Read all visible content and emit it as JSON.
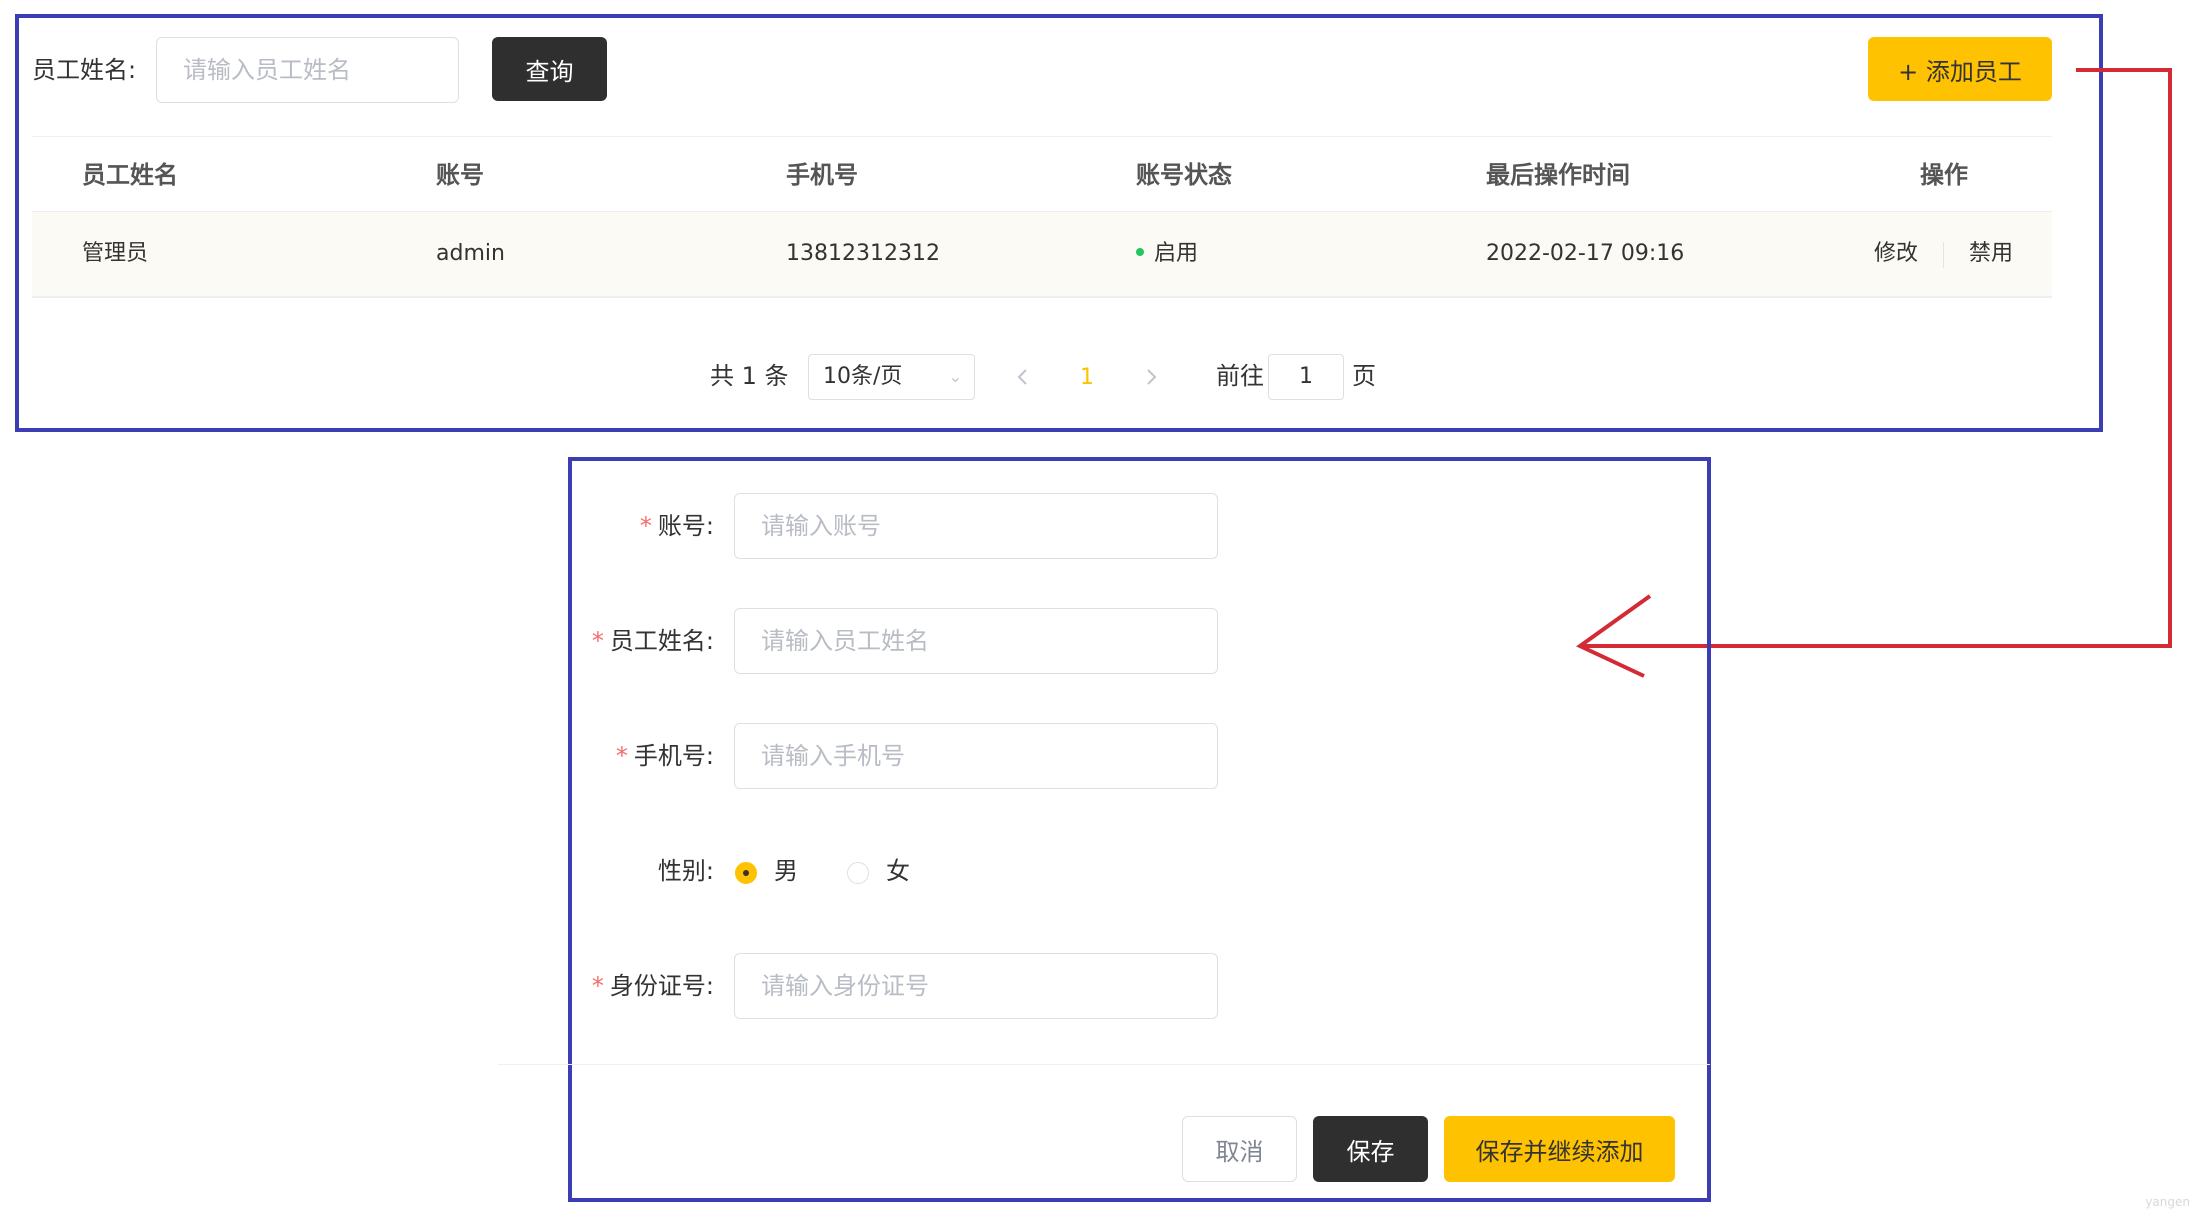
{
  "search": {
    "label": "员工姓名:",
    "placeholder": "请输入员工姓名",
    "query_button": "查询",
    "add_button": "+ 添加员工"
  },
  "table": {
    "headers": [
      "员工姓名",
      "账号",
      "手机号",
      "账号状态",
      "最后操作时间",
      "操作"
    ],
    "rows": [
      {
        "name": "管理员",
        "account": "admin",
        "phone": "13812312312",
        "status": "启用",
        "last_op_time": "2022-02-17 09:16",
        "edit": "修改",
        "disable": "禁用"
      }
    ]
  },
  "pagination": {
    "total_text": "共 1 条",
    "page_size": "10条/页",
    "current_page": "1",
    "goto_prefix": "前往",
    "goto_value": "1",
    "goto_suffix": "页"
  },
  "form": {
    "account_label": "账号:",
    "account_placeholder": "请输入账号",
    "name_label": "员工姓名:",
    "name_placeholder": "请输入员工姓名",
    "phone_label": "手机号:",
    "phone_placeholder": "请输入手机号",
    "gender_label": "性别:",
    "gender_male": "男",
    "gender_female": "女",
    "gender_selected": "男",
    "idcard_label": "身份证号:",
    "idcard_placeholder": "请输入身份证号",
    "required_mark": "*",
    "cancel": "取消",
    "save": "保存",
    "save_continue": "保存并继续添加"
  },
  "colors": {
    "accent": "#ffc200",
    "dark_button": "#2f2f2f",
    "frame": "#3c3cb4",
    "arrow": "#d42a35",
    "status_enabled": "#22c55e",
    "required": "#f56c6c"
  },
  "watermark": "yangen"
}
